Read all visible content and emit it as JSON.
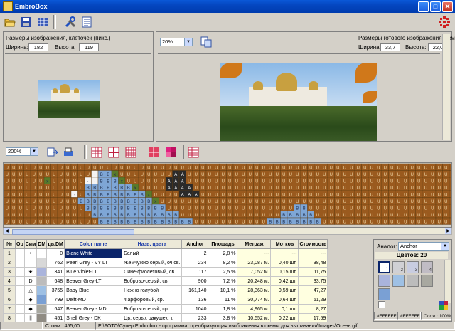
{
  "window": {
    "title": "EmbroBox"
  },
  "toolbar": {
    "icons": [
      "open-folder-icon",
      "save-icon",
      "grid-view-icon",
      "tools-icon",
      "list-icon"
    ]
  },
  "source_panel": {
    "heading": "Размеры изображения, клеточек (пикс.)",
    "width_label": "Ширина:",
    "width_value": "182",
    "height_label": "Высота:",
    "height_value": "119"
  },
  "result_panel": {
    "zoom_value": "20%",
    "heading": "Размеры готового изображения в см.:",
    "width_label": "Ширина:",
    "width_value": "33,7",
    "height_label": "Высота:",
    "height_value": "22,0"
  },
  "pattern_toolbar": {
    "zoom_value": "200%"
  },
  "pattern_grid": {
    "colors": {
      "U": "#9a5a1e",
      "B": "#7ea6d6",
      "w": "#f4f4f4",
      "A": "#2a2a2a",
      "x": "#5a7a2a"
    },
    "rows": [
      "UUUUUUUUUUUUUUUUUUUUUUUUUUUUUUUUUUUUUUUUUUUUUUUUUUUUUUUUUUUUUUUUUUU",
      "UUUUUUUUUUUUUwBBxUUUUUUUUAAUUUUUUUUUUUUUUUUUUUUUUUUUUUUUUUUUUUUUUUU",
      "UUUUUUxUUUUUwwBBBxUUUUUUAAAUUUUUUUUUUUUUUUUUUUUUUUUUUUUUUUUUUUUUUUU",
      "UUUUUUUUUUUUBBBBBBBxUUUUAAAAUUUUUUUUUUUUUUUUUUUUUUUUUUUUUUUUUUUUUUU",
      "UUUUUUUUUUwUBBBBBBBBBxUUUUAAAUUUUUUUUUUUUUUUUUUUUUUUUUUUUUUUUUUUUUU",
      "UUUUUUUUUUUBBBBBBBBBBBxUUUUUUUUUUUUUUUUUUUUUUUUUUUUUUUUUUUUUUUUUUUU",
      "UUUUUUUUUUUUBBBBBBBBBBBBUUUUUUUUUUUUUUUUUUUBBUUUUUUUUUUUUUUUUUUUUUU",
      "UUUUUUUUUUUUUBBBBBBBBBBBBBUUUUUUUUUUUUUUUBBBBBUUUUUUUUUUUUUUUUUUUUU",
      "UUUUUUUUUUUUUUBBBBBBBBBBBBBBUUUUUUUUUUUBBBBBBBBUUUUUUUUUUUUUUUUUUUU"
    ]
  },
  "color_table": {
    "headers": [
      "№",
      "Op",
      "Сим",
      "DM",
      "цв.DM",
      "Color name",
      "Назв. цвета",
      "Anchor",
      "Площадь",
      "Метраж",
      "Мотков",
      "Стоимость"
    ],
    "rows": [
      {
        "n": "1",
        "sym": "•",
        "dm": "0",
        "color": "#ffffff",
        "name": "Blanc White",
        "ru": "Белый",
        "anchor": "2",
        "area": "2,8 %",
        "len": "---",
        "skeins": "---",
        "cost": "---"
      },
      {
        "n": "2",
        "sym": "—",
        "dm": "762",
        "color": "#d8d8d8",
        "name": "Pearl Grey - VY LT",
        "ru": "Жемчужно серый, оч.св.",
        "anchor": "234",
        "area": "8,2 %",
        "len": "23,087 м.",
        "skeins": "0,40 шт.",
        "cost": "38,48"
      },
      {
        "n": "3",
        "sym": "★",
        "dm": "341",
        "color": "#aab4dc",
        "name": "Blue Violet-LT",
        "ru": "Сине-фиолетовый, св.",
        "anchor": "117",
        "area": "2,5 %",
        "len": "7,052 м.",
        "skeins": "0,15 шт.",
        "cost": "11,75"
      },
      {
        "n": "4",
        "sym": "D",
        "dm": "648",
        "color": "#bcbcbc",
        "name": "Beaver Grey-LT",
        "ru": "Боброво-серый, св.",
        "anchor": "900",
        "area": "7,2 %",
        "len": "20,248 м.",
        "skeins": "0,42 шт.",
        "cost": "33,75"
      },
      {
        "n": "5",
        "sym": "△",
        "dm": "3755",
        "color": "#9ec0e4",
        "name": "Baby Blue",
        "ru": "Нежно голубой",
        "anchor": "161,140",
        "area": "10,1 %",
        "len": "28,363 м.",
        "skeins": "0,59 шт.",
        "cost": "47,27"
      },
      {
        "n": "6",
        "sym": "◆",
        "dm": "799",
        "color": "#7aa0d4",
        "name": "Delft-MD",
        "ru": "Фарфоровый, ср.",
        "anchor": "136",
        "area": "11 %",
        "len": "30,774 м.",
        "skeins": "0,64 шт.",
        "cost": "51,29"
      },
      {
        "n": "7",
        "sym": "◆",
        "dm": "647",
        "color": "#a8a8a0",
        "name": "Beaver Grey - MD",
        "ru": "Боброво-серый, ср.",
        "anchor": "1040",
        "area": "1,8 %",
        "len": "4,965 м.",
        "skeins": "0,1 шт.",
        "cost": "8,27"
      },
      {
        "n": "8",
        "sym": "||",
        "dm": "451",
        "color": "#908c84",
        "name": "Shell Grey - DK",
        "ru": "Цв. серых ракушек, т.",
        "anchor": "233",
        "area": "3,8 %",
        "len": "10,552 м.",
        "skeins": "0,22 шт.",
        "cost": "17,59"
      }
    ]
  },
  "side_panel": {
    "analog_label": "Аналог:",
    "analog_value": "Anchor",
    "colors_count": "Цветов: 20",
    "swatches": [
      {
        "label": "1",
        "color": "#ffffff"
      },
      {
        "label": "2",
        "color": "#d0d0d4"
      },
      {
        "label": "3",
        "color": "#c8cce0"
      },
      {
        "label": "4",
        "color": "#c0bcc4"
      },
      {
        "label": "",
        "color": "#aab4dc"
      },
      {
        "label": "",
        "color": "#9ec0e4"
      },
      {
        "label": "",
        "color": "#bcbcbc"
      },
      {
        "label": "",
        "color": "#a8a8a0"
      },
      {
        "label": "",
        "color": "#7aa0d4"
      }
    ],
    "hex1": "#FFFFFF",
    "hex2": "#FFFFFF",
    "complexity": "Слож.: 100%"
  },
  "status": {
    "cost": "Стоим.: 455,00",
    "path": "E:\\FOTO\\Супер Embrobox - программа, преобразующая изображения в схемы для вышивания\\Images\\Осень.gif"
  }
}
